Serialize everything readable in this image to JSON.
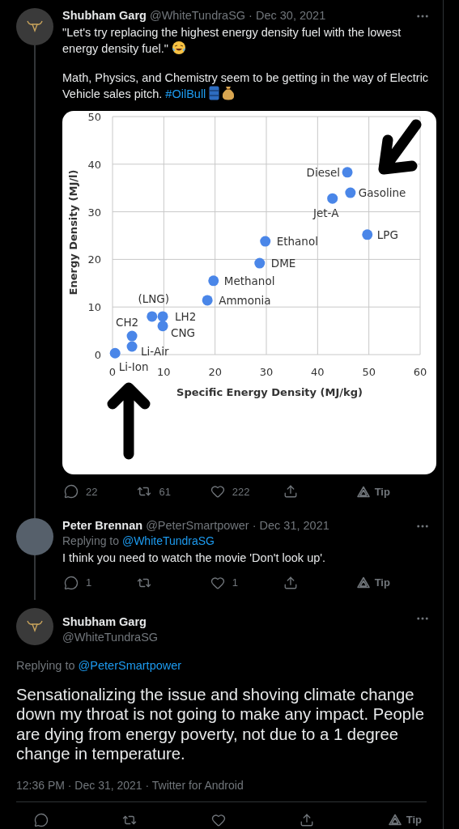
{
  "tweets": [
    {
      "kind": "compact",
      "name": "Shubham Garg",
      "meta": "@WhiteTundraSG · Dec 30, 2021",
      "avatar": {
        "kind": "logo"
      },
      "thread_below": true,
      "paragraphs": [
        {
          "text": "\"Let's try replacing the highest energy density fuel with the lowest energy density fuel.\"",
          "emoji": [
            {
              "kind": "laughing"
            }
          ]
        },
        {
          "text": "Math, Physics, and Chemistry seem to be getting in the way of Electric Vehicle sales pitch.",
          "link": "#OilBull",
          "emoji": [
            {
              "kind": "barrel"
            },
            {
              "kind": "money-bag"
            }
          ]
        }
      ],
      "chart_data": {
        "type": "scatter",
        "grid": true,
        "xlabel": "Specific Energy Density (MJ/kg)",
        "ylabel": "Energy Density (MJ/l)",
        "xlim": [
          0,
          60
        ],
        "ylim": [
          0,
          50
        ],
        "xticks": [
          0,
          10,
          20,
          30,
          40,
          50,
          60
        ],
        "yticks": [
          0,
          10,
          20,
          30,
          40,
          50
        ],
        "x": [
          45.8,
          46.4,
          42.9,
          49.7,
          29.8,
          28.7,
          19.7,
          18.5,
          7.7,
          9.8,
          9.8,
          3.8,
          3.8,
          0.5
        ],
        "series": [
          {
            "color": "#4a86e8",
            "values": [
              38.3,
              34.0,
              32.8,
              25.2,
              23.8,
              19.2,
              15.5,
              11.4,
              8.0,
              8.0,
              6.0,
              3.9,
              1.7,
              0.3
            ]
          }
        ],
        "annotations": [
          "Diesel",
          "Gasoline",
          "Jet-A",
          "LPG",
          "Ethanol",
          "DME",
          "Methanol",
          "Ammonia",
          "(LNG)",
          "LH2",
          "CNG",
          "CH2",
          "Li-Air",
          "Li-Ion"
        ]
      },
      "actions": [
        {
          "kind": "reply",
          "count": "22"
        },
        {
          "kind": "retweet",
          "count": "61"
        },
        {
          "kind": "like",
          "count": "222"
        },
        {
          "kind": "share"
        },
        {
          "kind": "tip",
          "label": "Tip"
        }
      ]
    },
    {
      "kind": "compact",
      "name": "Peter Brennan",
      "meta": "@PeterSmartpower · Dec 31, 2021",
      "avatar": {
        "kind": "photo"
      },
      "thread_below": true,
      "replying_label": "Replying to",
      "replying_to": "@WhiteTundraSG",
      "paragraphs": [
        {
          "text": "I think you need to watch the movie 'Don't look up'."
        }
      ],
      "actions": [
        {
          "kind": "reply",
          "count": "1"
        },
        {
          "kind": "retweet"
        },
        {
          "kind": "like",
          "count": "1"
        },
        {
          "kind": "share"
        },
        {
          "kind": "tip",
          "label": "Tip"
        }
      ]
    },
    {
      "kind": "focus",
      "name": "Shubham Garg",
      "meta": "@WhiteTundraSG",
      "avatar": {
        "kind": "logo"
      },
      "thread_below": false,
      "replying_label": "Replying to",
      "replying_to": "@PeterSmartpower",
      "paragraphs": [
        {
          "text": "Sensationalizing the issue and shoving climate change down my throat is not going to make any impact. People are dying from energy poverty, not due to a 1 degree change in temperature."
        }
      ],
      "footer": "12:36 PM · Dec 31, 2021 · Twitter for Android",
      "actions": [
        {
          "kind": "reply"
        },
        {
          "kind": "retweet"
        },
        {
          "kind": "like"
        },
        {
          "kind": "share"
        },
        {
          "kind": "tip",
          "label": "Tip"
        }
      ]
    }
  ]
}
